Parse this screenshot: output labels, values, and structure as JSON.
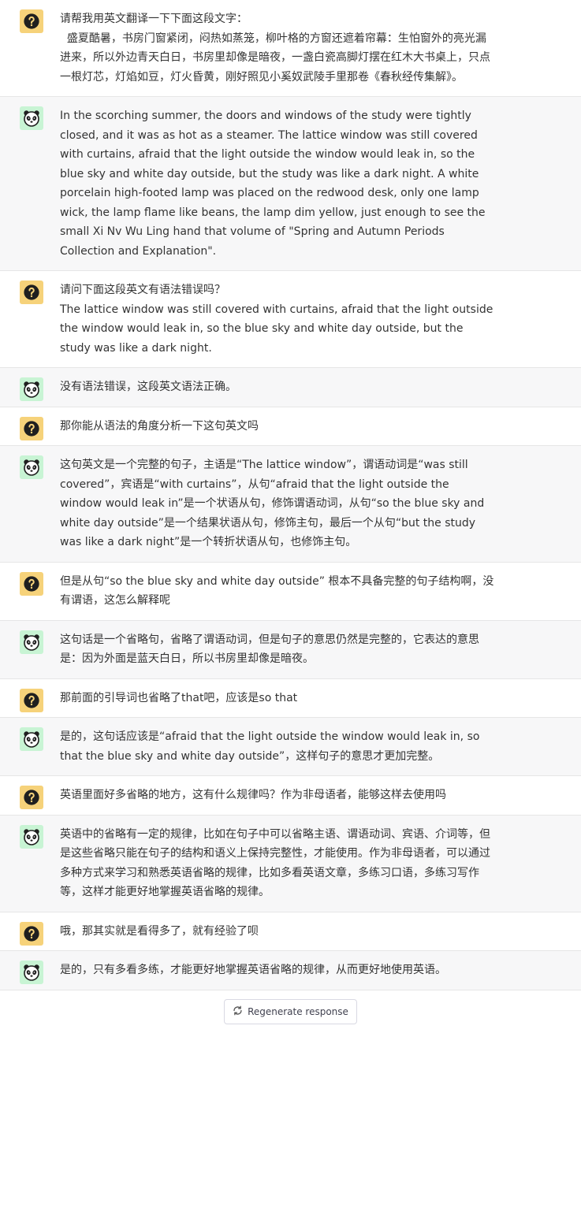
{
  "messages": [
    {
      "role": "user",
      "text": "请帮我用英文翻译一下下面这段文字：\n  盛夏酷暑，书房门窗紧闭，闷热如蒸笼，柳叶格的方窗还遮着帘幕：生怕窗外的亮光漏进来，所以外边青天白日，书房里却像是暗夜，一盏白瓷高脚灯摆在红木大书桌上，只点一根灯芯，灯焰如豆，灯火昏黄，刚好照见小奚奴武陵手里那卷《春秋经传集解》。"
    },
    {
      "role": "bot",
      "text": "In the scorching summer, the doors and windows of the study were tightly closed, and it was as hot as a steamer. The lattice window was still covered with curtains, afraid that the light outside the window would leak in, so the blue sky and white day outside, but the study was like a dark night. A white porcelain high-footed lamp was placed on the redwood desk, only one lamp wick, the lamp flame like beans, the lamp dim yellow, just enough to see the small Xi Nv Wu Ling hand that volume of \"Spring and Autumn Periods Collection and Explanation\"."
    },
    {
      "role": "user",
      "text": "请问下面这段英文有语法错误吗？\nThe lattice window was still covered with curtains, afraid that the light outside the window would leak in, so the blue sky and white day outside, but the study was like a dark night."
    },
    {
      "role": "bot",
      "text": "没有语法错误，这段英文语法正确。"
    },
    {
      "role": "user",
      "text": "那你能从语法的角度分析一下这句英文吗"
    },
    {
      "role": "bot",
      "text": "这句英文是一个完整的句子，主语是“The lattice window”，谓语动词是“was still covered”，宾语是“with curtains”，从句“afraid that the light outside the window would leak in”是一个状语从句，修饰谓语动词，从句“so the blue sky and white day outside”是一个结果状语从句，修饰主句，最后一个从句“but the study was like a dark night”是一个转折状语从句，也修饰主句。"
    },
    {
      "role": "user",
      "text": "但是从句“so the blue sky and white day outside” 根本不具备完整的句子结构啊，没有谓语，这怎么解释呢"
    },
    {
      "role": "bot",
      "text": "这句话是一个省略句，省略了谓语动词，但是句子的意思仍然是完整的，它表达的意思是：因为外面是蓝天白日，所以书房里却像是暗夜。"
    },
    {
      "role": "user",
      "text": "那前面的引导词也省略了that吧，应该是so that"
    },
    {
      "role": "bot",
      "text": "是的，这句话应该是“afraid that the light outside the window would leak in, so that the blue sky and white day outside”，这样句子的意思才更加完整。"
    },
    {
      "role": "user",
      "text": "英语里面好多省略的地方，这有什么规律吗？作为非母语者，能够这样去使用吗"
    },
    {
      "role": "bot",
      "text": "英语中的省略有一定的规律，比如在句子中可以省略主语、谓语动词、宾语、介词等，但是这些省略只能在句子的结构和语义上保持完整性，才能使用。作为非母语者，可以通过多种方式来学习和熟悉英语省略的规律，比如多看英语文章，多练习口语，多练习写作等，这样才能更好地掌握英语省略的规律。"
    },
    {
      "role": "user",
      "text": "哦，那其实就是看得多了，就有经验了呗"
    },
    {
      "role": "bot",
      "text": "是的，只有多看多练，才能更好地掌握英语省略的规律，从而更好地使用英语。"
    }
  ],
  "icons": {
    "user_avatar": "question-mark-icon",
    "bot_avatar": "panda-icon",
    "regenerate": "refresh-icon"
  },
  "colors": {
    "user_avatar_bg": "#f6d27a",
    "bot_avatar_bg": "#c8f4d4",
    "bot_row_bg": "#f7f7f8"
  },
  "footer": {
    "regenerate_label": "Regenerate response"
  }
}
